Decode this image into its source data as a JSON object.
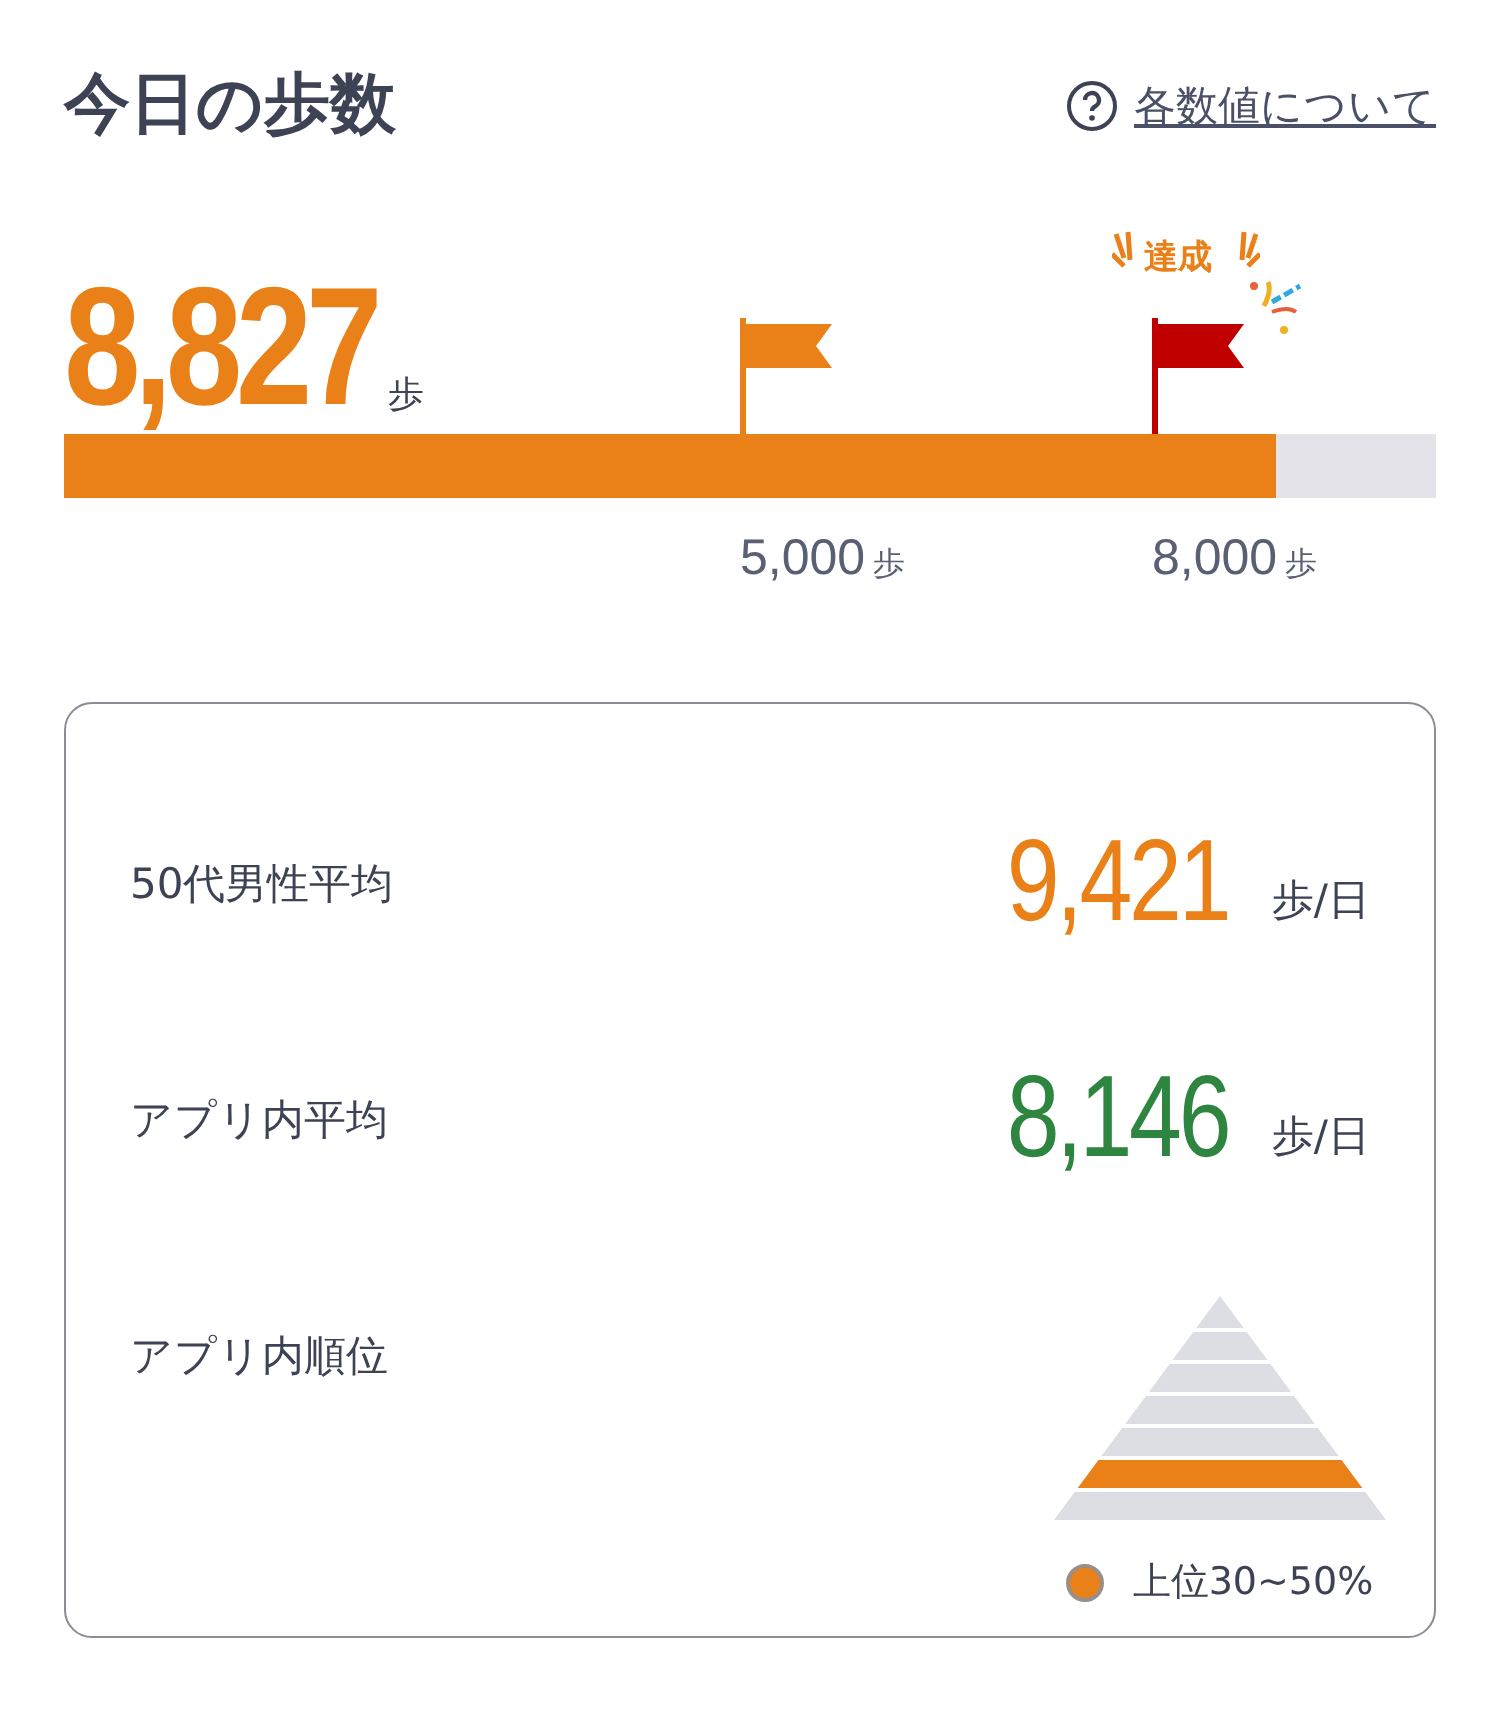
{
  "header": {
    "title": "今日の歩数",
    "help_link": "各数値について"
  },
  "today": {
    "steps": "8,827",
    "unit": "歩",
    "level": 0.883
  },
  "goals": [
    {
      "value": "5,000",
      "unit": "歩",
      "achieved": false
    },
    {
      "value": "8,000",
      "unit": "歩",
      "achieved": true,
      "badge": "達成"
    }
  ],
  "comparison": {
    "rows": [
      {
        "kind": "value",
        "label": "50代男性平均",
        "value": "9,421",
        "unit": "歩/日",
        "color": "#ea8118"
      },
      {
        "kind": "value",
        "label": "アプリ内平均",
        "value": "8,146",
        "unit": "歩/日",
        "color": "#2e8540"
      },
      {
        "kind": "rank",
        "label": "アプリ内順位",
        "tiers": [
          {
            "selected": false
          },
          {
            "selected": false
          },
          {
            "selected": false
          },
          {
            "selected": false
          },
          {
            "selected": false
          },
          {
            "selected": true
          },
          {
            "selected": false
          }
        ],
        "legend": "上位30~50%",
        "color": "#ea8118"
      }
    ]
  }
}
